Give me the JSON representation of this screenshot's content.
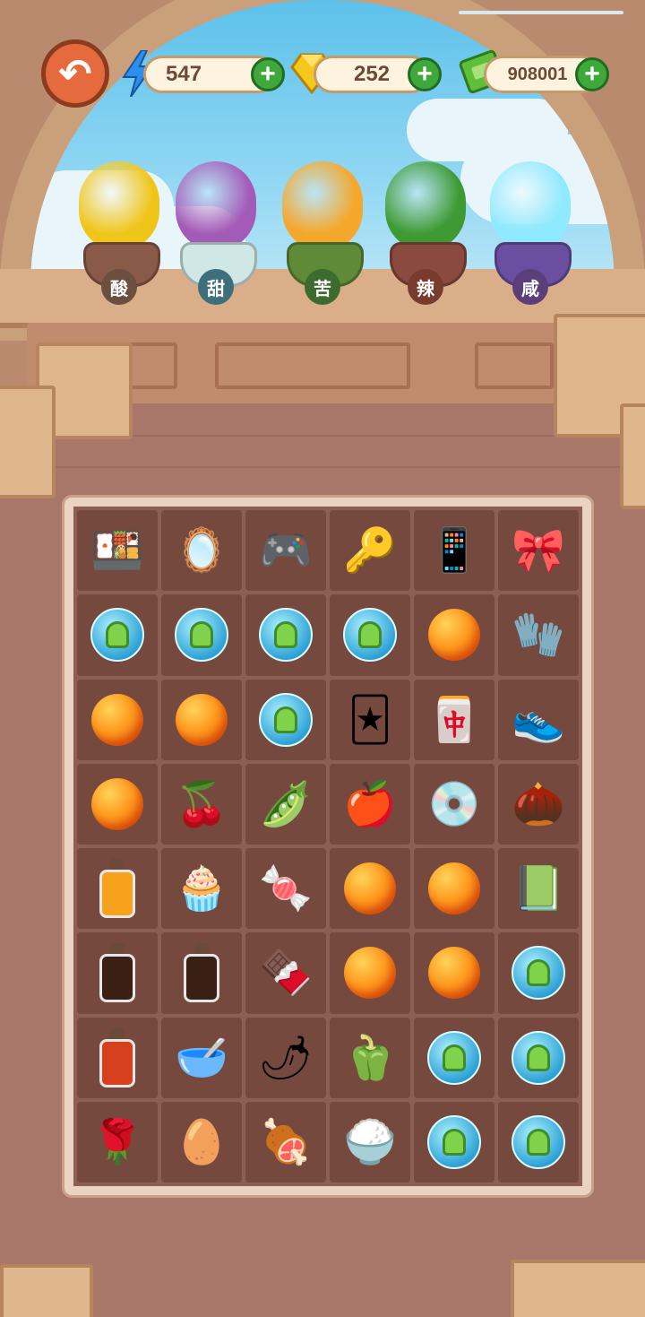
{
  "hud": {
    "energy": "547",
    "gems": "252",
    "cash": "908001",
    "plus": "+",
    "back": "↶"
  },
  "plants": [
    {
      "label": "酸",
      "label_color": "#6b4f3f",
      "leaf": "#f0c51a",
      "pot": "#8a5a48"
    },
    {
      "label": "甜",
      "label_color": "#3f6f7a",
      "leaf": "#a35bb8",
      "pot": "#cfe8e6"
    },
    {
      "label": "苦",
      "label_color": "#3d6b2f",
      "leaf": "#f4a72a",
      "pot": "#5f8a38"
    },
    {
      "label": "辣",
      "label_color": "#7a3b2f",
      "leaf": "#3f9a33",
      "pot": "#8a4a3d"
    },
    {
      "label": "咸",
      "label_color": "#5a3f7a",
      "leaf": "#8fe9ff",
      "pot": "#6a4fa0"
    }
  ],
  "board": [
    [
      "lunchbox-icon",
      "mirror-icon",
      "game-console-icon",
      "car-key-icon",
      "phone-icon",
      "pink-pillow-icon"
    ],
    [
      "sprout-bubble",
      "sprout-bubble",
      "sprout-bubble",
      "sprout-bubble",
      "orange-orb",
      "mitten-icon"
    ],
    [
      "orange-orb",
      "orange-orb",
      "sprout-bubble",
      "trading-card-icon",
      "mahjong-tile-icon",
      "sneaker-icon"
    ],
    [
      "orange-orb",
      "lychee-icon",
      "tamarind-icon",
      "hawthorn-icon",
      "cd-case-icon",
      "walnut-icon"
    ],
    [
      "juice-bottle-icon",
      "cream-puff-icon",
      "candy-icon",
      "orange-orb",
      "orange-orb",
      "notebook-icon"
    ],
    [
      "soy-sauce-bottle-icon",
      "soy-sauce-bottle-icon",
      "chocolate-icon",
      "orange-orb",
      "orange-orb",
      "sprout-bubble"
    ],
    [
      "chili-oil-bottle-icon",
      "chili-powder-icon",
      "red-pepper-icon",
      "green-pepper-icon",
      "sprout-bubble",
      "sprout-bubble"
    ],
    [
      "rose-icon",
      "salted-egg-icon",
      "ham-icon",
      "salt-bowl-icon",
      "sprout-bubble",
      "sprout-bubble"
    ]
  ],
  "glyphs": {
    "lunchbox-icon": "🍱",
    "mirror-icon": "🪞",
    "game-console-icon": "🎮",
    "car-key-icon": "🔑",
    "phone-icon": "📱",
    "pink-pillow-icon": "🎀",
    "mitten-icon": "🧤",
    "trading-card-icon": "🃏",
    "mahjong-tile-icon": "🀄",
    "sneaker-icon": "👟",
    "lychee-icon": "🍒",
    "tamarind-icon": "🫛",
    "hawthorn-icon": "🍎",
    "cd-case-icon": "💿",
    "walnut-icon": "🌰",
    "cream-puff-icon": "🧁",
    "candy-icon": "🍬",
    "notebook-icon": "📗",
    "chocolate-icon": "🍫",
    "chili-powder-icon": "🥣",
    "red-pepper-icon": "🌶",
    "green-pepper-icon": "🫑",
    "rose-icon": "🌹",
    "salted-egg-icon": "🥚",
    "ham-icon": "🍖",
    "salt-bowl-icon": "🍚"
  },
  "bottle_colors": {
    "juice-bottle-icon": "#f6a21c",
    "soy-sauce-bottle-icon": "#3a1f14",
    "chili-oil-bottle-icon": "#d6401e"
  }
}
